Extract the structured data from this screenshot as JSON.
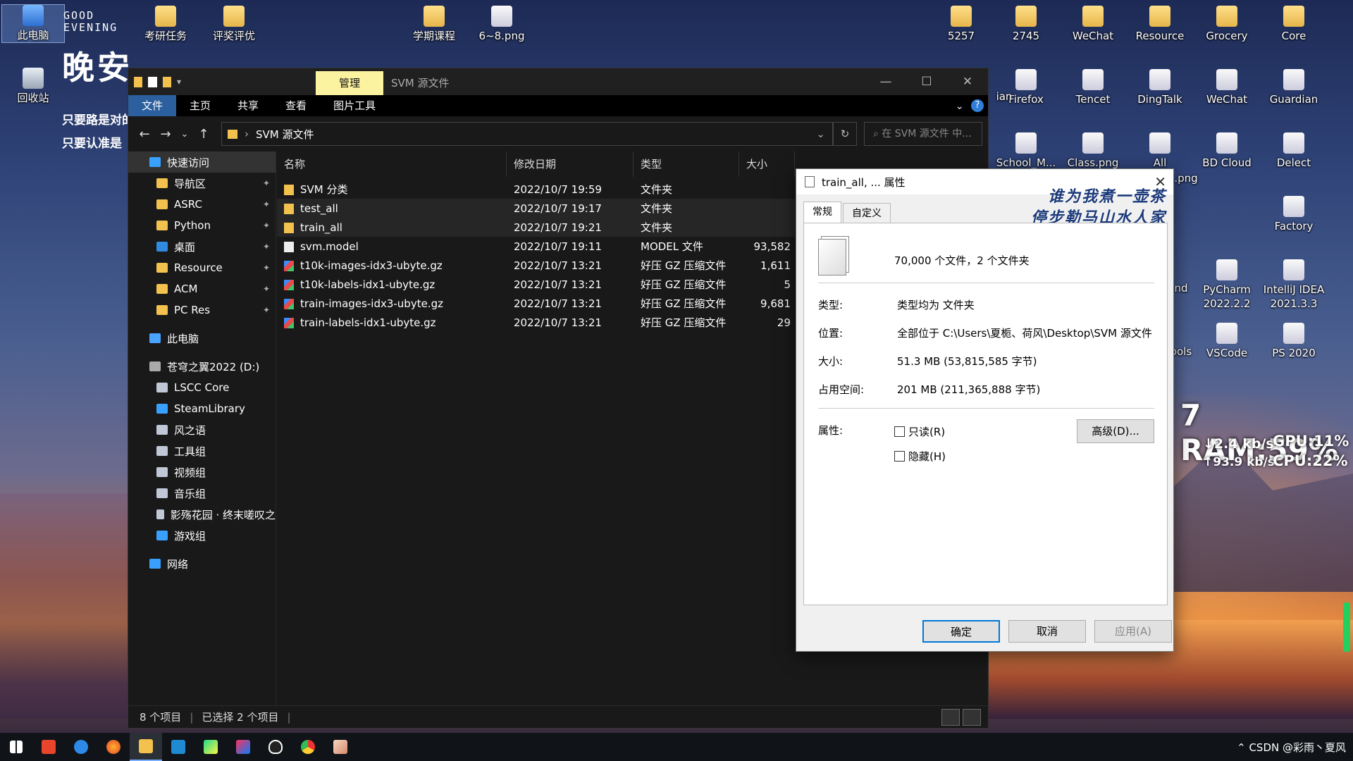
{
  "desktop": {
    "greeting": [
      "GOOD",
      "EVENING"
    ],
    "big_text": "晚安",
    "poem_lines": [
      "只要路是对的",
      "只要认准是"
    ],
    "stamp_lines": [
      "谁为我煮一壶茶",
      "停步勒马山水人家"
    ],
    "sysmon": {
      "ram": "7 RAM:59%",
      "down": "↓2.4 kb/s",
      "gpu": "GPU:11%",
      "up": "↑93.9 kb/s",
      "cpu": "CPU:22%"
    },
    "icons_left": [
      "此电脑",
      "回收站"
    ],
    "icons_top": [
      "考研任务",
      "评奖评优",
      "学期课程",
      "6~8.png"
    ],
    "icons_right_row1": [
      "5257",
      "2745",
      "WeChat",
      "Resource",
      "Grocery",
      "Core"
    ],
    "icons_right_row2": [
      "ian",
      "Firefox",
      "Tencet",
      "DingTalk",
      "WeChat",
      "Guardian"
    ],
    "icons_right_row3": [
      "School_M...",
      "Class.png",
      "All",
      "BD Cloud",
      "Delect"
    ],
    "icons_right_row3_sub": ".png",
    "icons_right_extra": [
      "Factory",
      "PyCharm",
      "2022.2.2",
      "IntelliJ IDEA",
      "2021.3.3",
      "VSCode",
      "PS 2020",
      "nd",
      "ools"
    ]
  },
  "explorer": {
    "title": "SVM 源文件",
    "context_tab": "管理",
    "ribbon_tabs": [
      "文件",
      "主页",
      "共享",
      "查看",
      "图片工具"
    ],
    "path": "SVM 源文件",
    "search_placeholder": "在 SVM 源文件 中...",
    "nav": [
      {
        "label": "快速访问",
        "type": "star",
        "indent": 0,
        "selected": true
      },
      {
        "label": "导航区",
        "type": "folder",
        "indent": 1,
        "pin": true
      },
      {
        "label": "ASRC",
        "type": "folder",
        "indent": 1,
        "pin": true
      },
      {
        "label": "Python",
        "type": "folder",
        "indent": 1,
        "pin": true
      },
      {
        "label": "桌面",
        "type": "desk",
        "indent": 1,
        "pin": true
      },
      {
        "label": "Resource",
        "type": "folder",
        "indent": 1,
        "pin": true
      },
      {
        "label": "ACM",
        "type": "folder",
        "indent": 1,
        "pin": true
      },
      {
        "label": "PC Res",
        "type": "folder",
        "indent": 1,
        "pin": true
      },
      {
        "label": "此电脑",
        "type": "pc",
        "indent": 0
      },
      {
        "label": "苍穹之翼2022 (D:)",
        "type": "drive",
        "indent": 0
      },
      {
        "label": "LSCC Core",
        "type": "app",
        "indent": 1
      },
      {
        "label": "SteamLibrary",
        "type": "star",
        "indent": 1
      },
      {
        "label": "风之语",
        "type": "app",
        "indent": 1
      },
      {
        "label": "工具组",
        "type": "app",
        "indent": 1
      },
      {
        "label": "视频组",
        "type": "app",
        "indent": 1
      },
      {
        "label": "音乐组",
        "type": "app",
        "indent": 1
      },
      {
        "label": "影殇花园 · 终末嗟叹之",
        "type": "app",
        "indent": 1
      },
      {
        "label": "游戏组",
        "type": "star",
        "indent": 1
      },
      {
        "label": "网络",
        "type": "net",
        "indent": 0
      }
    ],
    "columns": [
      "名称",
      "修改日期",
      "类型",
      "大小"
    ],
    "files": [
      {
        "name": "SVM 分类",
        "date": "2022/10/7 19:59",
        "type": "文件夹",
        "size": "",
        "kind": "folder"
      },
      {
        "name": "test_all",
        "date": "2022/10/7 19:17",
        "type": "文件夹",
        "size": "",
        "kind": "folder",
        "selected": true
      },
      {
        "name": "train_all",
        "date": "2022/10/7 19:21",
        "type": "文件夹",
        "size": "",
        "kind": "folder",
        "selected": true
      },
      {
        "name": "svm.model",
        "date": "2022/10/7 19:11",
        "type": "MODEL 文件",
        "size": "93,582",
        "kind": "file"
      },
      {
        "name": "t10k-images-idx3-ubyte.gz",
        "date": "2022/10/7 13:21",
        "type": "好压 GZ 压缩文件",
        "size": "1,611",
        "kind": "gz"
      },
      {
        "name": "t10k-labels-idx1-ubyte.gz",
        "date": "2022/10/7 13:21",
        "type": "好压 GZ 压缩文件",
        "size": "5",
        "kind": "gz"
      },
      {
        "name": "train-images-idx3-ubyte.gz",
        "date": "2022/10/7 13:21",
        "type": "好压 GZ 压缩文件",
        "size": "9,681",
        "kind": "gz"
      },
      {
        "name": "train-labels-idx1-ubyte.gz",
        "date": "2022/10/7 13:21",
        "type": "好压 GZ 压缩文件",
        "size": "29",
        "kind": "gz"
      }
    ],
    "status_count": "8 个项目",
    "status_selected": "已选择 2 个项目"
  },
  "dialog": {
    "title": "train_all, ... 属性",
    "tabs": [
      "常规",
      "自定义"
    ],
    "summary": "70,000 个文件，2 个文件夹",
    "rows": [
      {
        "label": "类型:",
        "value": "类型均为 文件夹"
      },
      {
        "label": "位置:",
        "value": "全部位于 C:\\Users\\夏栀、荷风\\Desktop\\SVM 源文件"
      },
      {
        "label": "大小:",
        "value": "51.3 MB (53,815,585 字节)"
      },
      {
        "label": "占用空间:",
        "value": "201 MB (211,365,888 字节)"
      }
    ],
    "attr_label": "属性:",
    "readonly": "只读(R)",
    "hidden": "隐藏(H)",
    "advanced": "高级(D)...",
    "ok": "确定",
    "cancel": "取消",
    "apply": "应用(A)"
  },
  "taskbar": {
    "tray_text": "CSDN @彩雨丶夏风"
  }
}
